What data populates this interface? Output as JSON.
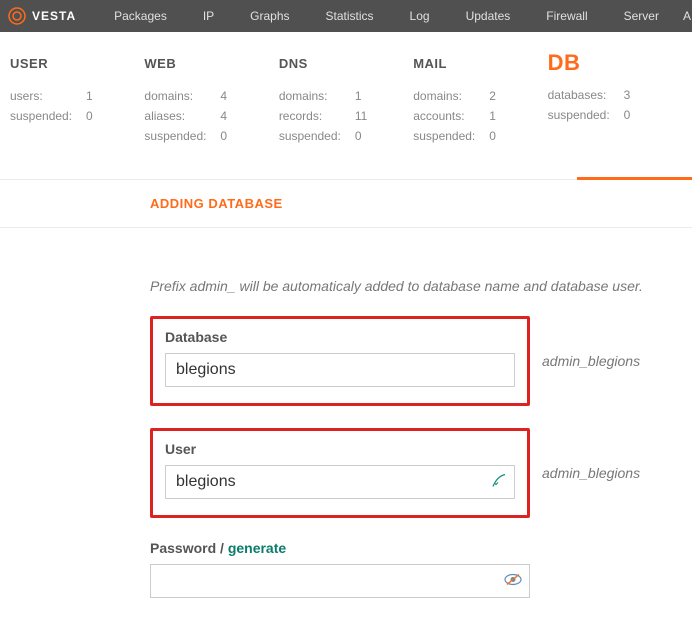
{
  "brand": "VESTA",
  "nav": [
    "Packages",
    "IP",
    "Graphs",
    "Statistics",
    "Log",
    "Updates",
    "Firewall",
    "Server",
    "A"
  ],
  "stats": {
    "user": {
      "title": "USER",
      "rows": [
        {
          "label": "users:",
          "value": "1"
        },
        {
          "label": "suspended:",
          "value": "0"
        }
      ]
    },
    "web": {
      "title": "WEB",
      "rows": [
        {
          "label": "domains:",
          "value": "4"
        },
        {
          "label": "aliases:",
          "value": "4"
        },
        {
          "label": "suspended:",
          "value": "0"
        }
      ]
    },
    "dns": {
      "title": "DNS",
      "rows": [
        {
          "label": "domains:",
          "value": "1"
        },
        {
          "label": "records:",
          "value": "11"
        },
        {
          "label": "suspended:",
          "value": "0"
        }
      ]
    },
    "mail": {
      "title": "MAIL",
      "rows": [
        {
          "label": "domains:",
          "value": "2"
        },
        {
          "label": "accounts:",
          "value": "1"
        },
        {
          "label": "suspended:",
          "value": "0"
        }
      ]
    },
    "db": {
      "title": "DB",
      "rows": [
        {
          "label": "databases:",
          "value": "3"
        },
        {
          "label": "suspended:",
          "value": "0"
        }
      ]
    }
  },
  "section_title": "ADDING DATABASE",
  "hint": "Prefix admin_ will be automaticaly added to database name and database user.",
  "form": {
    "database": {
      "label": "Database",
      "value": "blegions",
      "suffix": "admin_blegions"
    },
    "user": {
      "label": "User",
      "value": "blegions",
      "suffix": "admin_blegions"
    },
    "password": {
      "label_prefix": "Password / ",
      "label_action": "generate",
      "value": ""
    }
  }
}
